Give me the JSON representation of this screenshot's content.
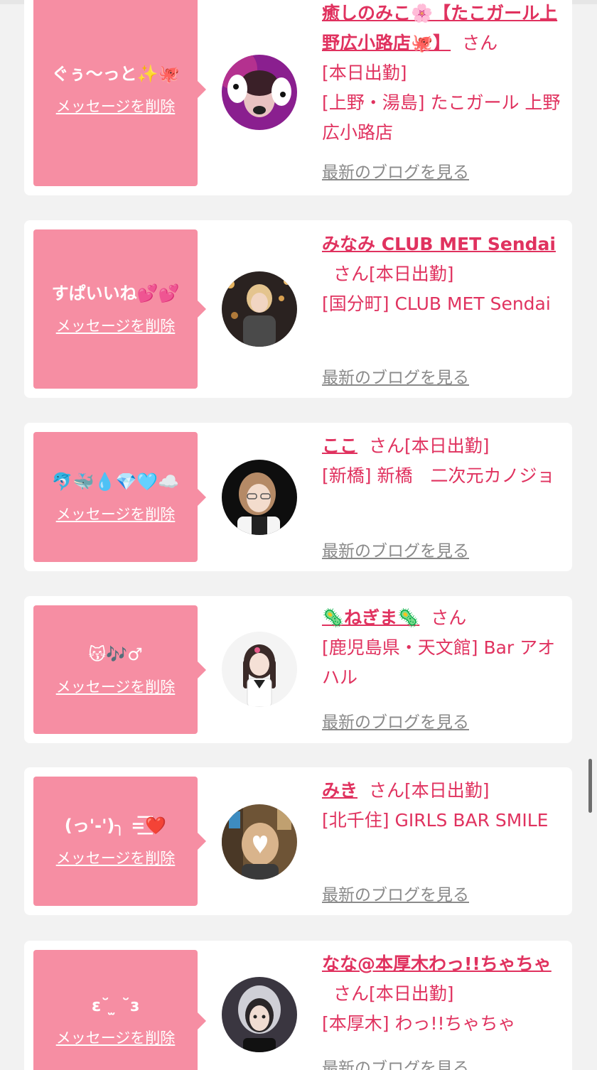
{
  "delete_label": "メッセージを削除",
  "blog_label": "最新のブログを見る",
  "colors": {
    "bubble": "#f68ea3",
    "name_text": "#e0325f",
    "blog_link": "#8a8a8a",
    "page_bg": "#f2f2f2"
  },
  "entries": [
    {
      "message": "ぐぅ〜っと✨🐙",
      "name": "癒しのみこ🌸【たこガール上野広小路店🐙】",
      "suffix": "さん",
      "status": "[本日出勤]",
      "area": "[上野・湯島] たこガール 上野広小路店"
    },
    {
      "message": "すぱいいね💕💕",
      "name": "みなみ CLUB MET Sendai",
      "suffix": "さん",
      "status": "[本日出勤]",
      "area": "[国分町] CLUB MET Sendai"
    },
    {
      "message": "🐬🐳💧💎🩵☁️",
      "name": "ここ",
      "suffix": "さん",
      "status": "[本日出勤]",
      "area": "[新橋] 新橋　二次元カノジョ"
    },
    {
      "message": "😽🎶♂",
      "name": "🦠ねぎま🦠",
      "suffix": "さん",
      "status": "",
      "area": "[鹿児島県・天文館] Bar アオハル"
    },
    {
      "message": "(っ'-')╮ =͟͟͞͞❤️",
      "name": "みき",
      "suffix": "さん",
      "status": "[本日出勤]",
      "area": "[北千住] GIRLS BAR SMILE"
    },
    {
      "message": "ɛ˘ ̫ ˘ɜ",
      "name": "なな@本厚木わっ!!ちゃちゃ",
      "suffix": "さん",
      "status": "[本日出勤]",
      "area": "[本厚木] わっ!!ちゃちゃ"
    }
  ]
}
